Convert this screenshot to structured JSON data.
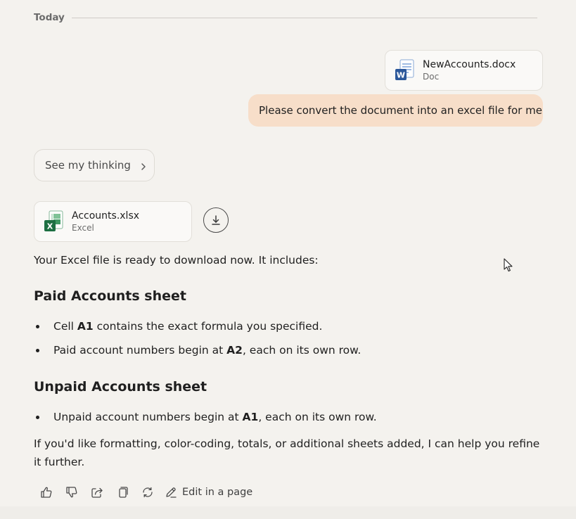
{
  "divider": {
    "label": "Today"
  },
  "user": {
    "attachment": {
      "name": "NewAccounts.docx",
      "type": "Doc",
      "icon": "word-document-icon",
      "badge": "W",
      "color": "#2b579a"
    },
    "message": "Please convert the document into an excel file for me"
  },
  "assistant": {
    "thinking_label": "See my thinking",
    "attachment": {
      "name": "Accounts.xlsx",
      "type": "Excel",
      "icon": "excel-spreadsheet-icon",
      "badge": "X",
      "color": "#1d6f42"
    },
    "download_icon": "download-icon",
    "intro": "Your Excel file is ready to download now. It includes:",
    "sections": [
      {
        "heading": "Paid Accounts sheet",
        "bullets": [
          {
            "pre": "Cell ",
            "bold": "A1",
            "post": " contains the exact formula you specified."
          },
          {
            "pre": "Paid account numbers begin at ",
            "bold": "A2",
            "post": ", each on its own row."
          }
        ]
      },
      {
        "heading": "Unpaid Accounts sheet",
        "bullets": [
          {
            "pre": "Unpaid account numbers begin at ",
            "bold": "A1",
            "post": ", each on its own row."
          }
        ]
      }
    ],
    "closing": "If you'd like formatting, color-coding, totals, or additional sheets added, I can help you refine it further."
  },
  "actions": {
    "icons": [
      "thumbs-up-icon",
      "thumbs-down-icon",
      "share-icon",
      "copy-icon",
      "regenerate-icon"
    ],
    "edit_label": "Edit in a page",
    "edit_icon": "pencil-icon"
  },
  "colors": {
    "background": "#f4f2ee",
    "user_bubble": "#f7dec9",
    "text": "#1f1f1f"
  }
}
